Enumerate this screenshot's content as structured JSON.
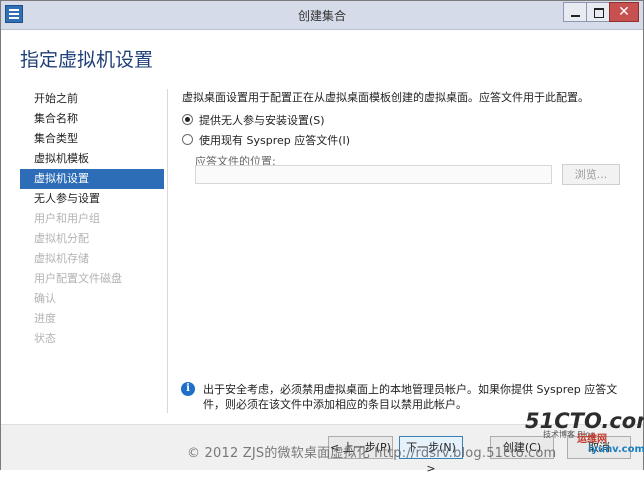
{
  "window": {
    "title": "创建集合"
  },
  "page": {
    "title": "指定虚拟机设置"
  },
  "nav": {
    "items": [
      {
        "label": "开始之前",
        "state": "normal"
      },
      {
        "label": "集合名称",
        "state": "normal"
      },
      {
        "label": "集合类型",
        "state": "normal"
      },
      {
        "label": "虚拟机模板",
        "state": "normal"
      },
      {
        "label": "虚拟机设置",
        "state": "selected"
      },
      {
        "label": "无人参与设置",
        "state": "normal"
      },
      {
        "label": "用户和用户组",
        "state": "disabled"
      },
      {
        "label": "虚拟机分配",
        "state": "disabled"
      },
      {
        "label": "虚拟机存储",
        "state": "disabled"
      },
      {
        "label": "用户配置文件磁盘",
        "state": "disabled"
      },
      {
        "label": "确认",
        "state": "disabled"
      },
      {
        "label": "进度",
        "state": "disabled"
      },
      {
        "label": "状态",
        "state": "disabled"
      }
    ]
  },
  "content": {
    "description": "虚拟桌面设置用于配置正在从虚拟桌面模板创建的虚拟桌面。应答文件用于此配置。",
    "option_unattended": "提供无人参与安装设置(S)",
    "option_sysprep": "使用现有 Sysprep 应答文件(I)",
    "selected_option": "unattended",
    "answer_file_label": "应答文件的位置:",
    "answer_file_value": "",
    "browse_label": "浏览..."
  },
  "info": {
    "text": "出于安全考虑，必须禁用虚拟桌面上的本地管理员帐户。如果你提供 Sysprep 应答文件，则必须在该文件中添加相应的条目以禁用此帐户。"
  },
  "footer": {
    "prev_label": "< 上一步(P)",
    "next_label": "下一步(N) >",
    "create_label": "创建(C)",
    "cancel_label": "取消"
  },
  "watermark": {
    "text": "© 2012 ZJS的微软桌面虚拟化 http://rdsrv.blog.51cto.com",
    "logo_text": "51CTO.com",
    "logo_sub": "技术博客 Blog",
    "logo_brand_1": "运维网",
    "logo_brand_2": "iyunv.com"
  },
  "colors": {
    "accent": "#2d6db8",
    "title": "#1f3f78"
  }
}
